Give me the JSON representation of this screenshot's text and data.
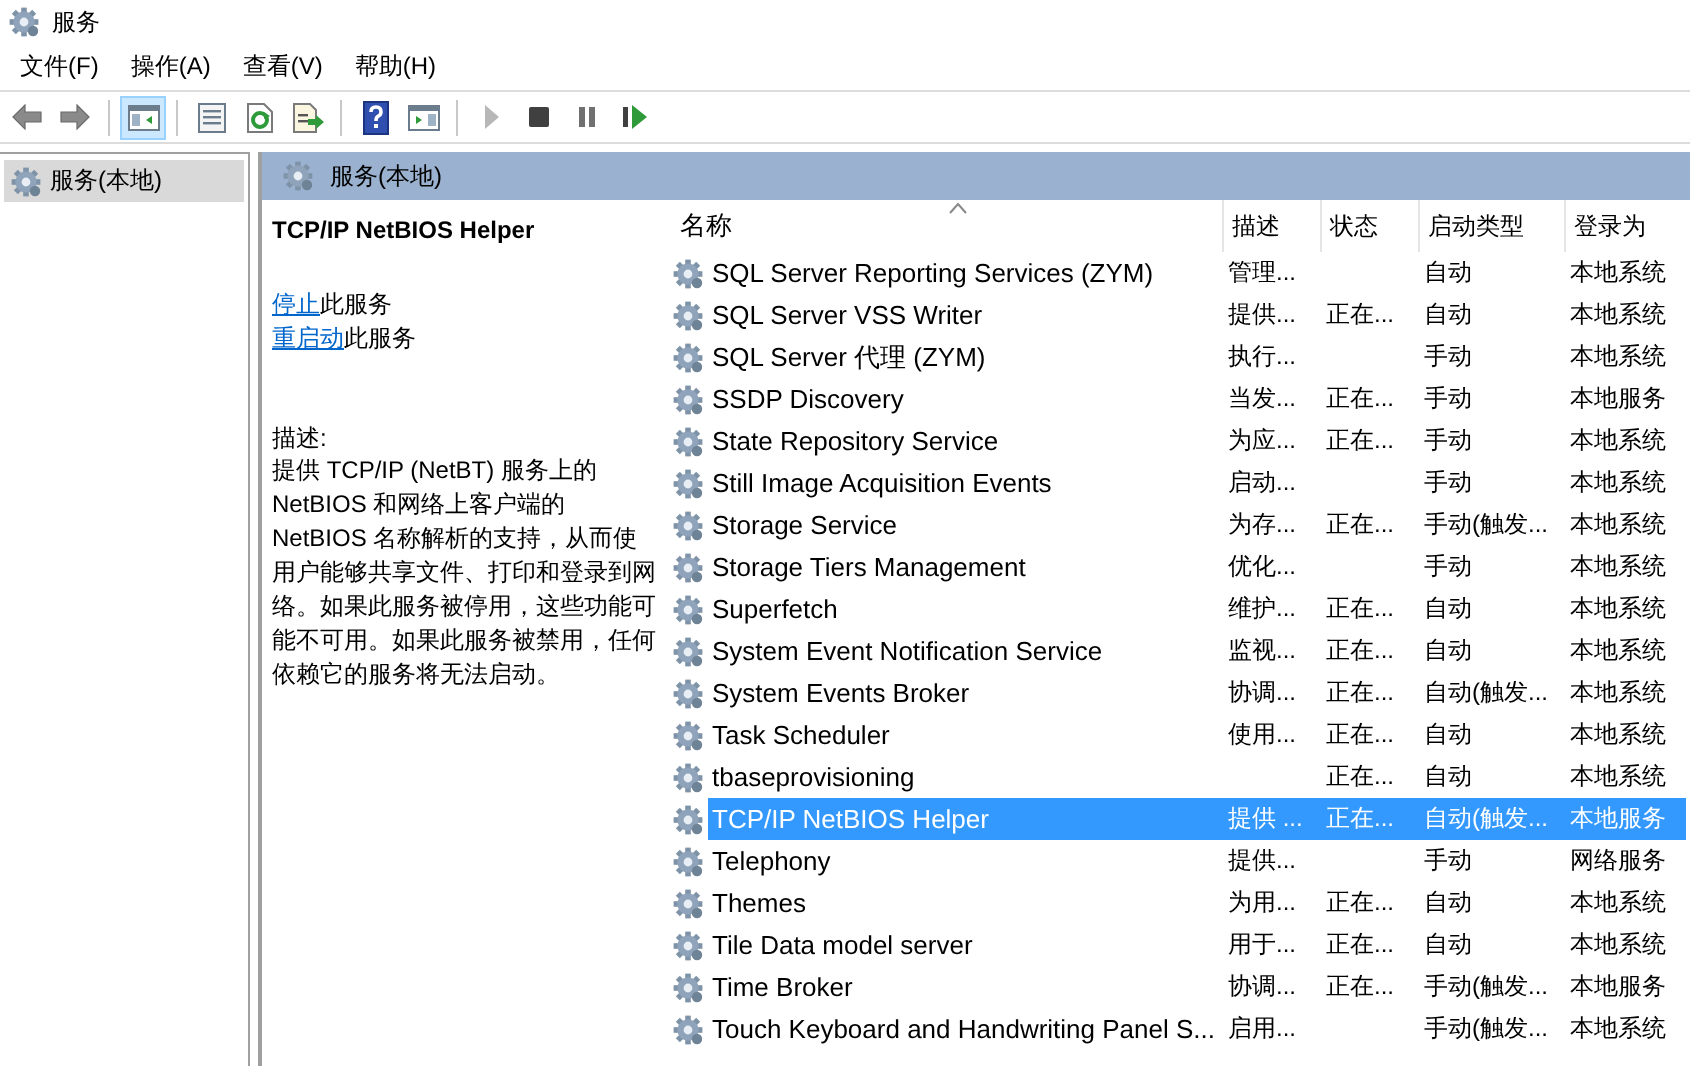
{
  "window": {
    "title": "服务"
  },
  "menu": [
    "文件(F)",
    "操作(A)",
    "查看(V)",
    "帮助(H)"
  ],
  "toolbar": [
    {
      "kind": "back",
      "selected": false,
      "disabled": false
    },
    {
      "kind": "forward",
      "selected": false,
      "disabled": false
    },
    {
      "kind": "sep"
    },
    {
      "kind": "tree",
      "selected": true,
      "disabled": false
    },
    {
      "kind": "sep"
    },
    {
      "kind": "properties",
      "selected": false,
      "disabled": false
    },
    {
      "kind": "refresh",
      "selected": false,
      "disabled": false
    },
    {
      "kind": "export",
      "selected": false,
      "disabled": false
    },
    {
      "kind": "sep"
    },
    {
      "kind": "help",
      "selected": false,
      "disabled": false
    },
    {
      "kind": "panel",
      "selected": false,
      "disabled": false
    },
    {
      "kind": "sep"
    },
    {
      "kind": "start",
      "selected": false,
      "disabled": true
    },
    {
      "kind": "stop",
      "selected": false,
      "disabled": false
    },
    {
      "kind": "pause",
      "selected": false,
      "disabled": false
    },
    {
      "kind": "resume",
      "selected": false,
      "disabled": false
    }
  ],
  "tree": [
    {
      "label": "服务(本地)",
      "selected": true
    }
  ],
  "header": {
    "title": "服务(本地)"
  },
  "details": {
    "title": "TCP/IP NetBIOS Helper",
    "actions": [
      {
        "link": "停止",
        "text": "此服务"
      },
      {
        "link": "重启动",
        "text": "此服务"
      }
    ],
    "description_label": "描述:",
    "description": "提供 TCP/IP (NetBT) 服务上的 NetBIOS 和网络上客户端的 NetBIOS 名称解析的支持，从而使用户能够共享文件、打印和登录到网络。如果此服务被停用，这些功能可能不可用。如果此服务被禁用，任何依赖它的服务将无法启动。"
  },
  "table": {
    "columns": [
      {
        "label": "名称",
        "sorted": true
      },
      {
        "label": "描述",
        "sorted": false
      },
      {
        "label": "状态",
        "sorted": false
      },
      {
        "label": "启动类型",
        "sorted": false
      },
      {
        "label": "登录为",
        "sorted": false
      }
    ],
    "rows": [
      {
        "cells": [
          "SQL Server Reporting Services (ZYM)",
          "管理...",
          "",
          "自动",
          "本地系统"
        ],
        "selected": false
      },
      {
        "cells": [
          "SQL Server VSS Writer",
          "提供...",
          "正在...",
          "自动",
          "本地系统"
        ],
        "selected": false
      },
      {
        "cells": [
          "SQL Server 代理 (ZYM)",
          "执行...",
          "",
          "手动",
          "本地系统"
        ],
        "selected": false
      },
      {
        "cells": [
          "SSDP Discovery",
          "当发...",
          "正在...",
          "手动",
          "本地服务"
        ],
        "selected": false
      },
      {
        "cells": [
          "State Repository Service",
          "为应...",
          "正在...",
          "手动",
          "本地系统"
        ],
        "selected": false
      },
      {
        "cells": [
          "Still Image Acquisition Events",
          "启动...",
          "",
          "手动",
          "本地系统"
        ],
        "selected": false
      },
      {
        "cells": [
          "Storage Service",
          "为存...",
          "正在...",
          "手动(触发...",
          "本地系统"
        ],
        "selected": false
      },
      {
        "cells": [
          "Storage Tiers Management",
          "优化...",
          "",
          "手动",
          "本地系统"
        ],
        "selected": false
      },
      {
        "cells": [
          "Superfetch",
          "维护...",
          "正在...",
          "自动",
          "本地系统"
        ],
        "selected": false
      },
      {
        "cells": [
          "System Event Notification Service",
          "监视...",
          "正在...",
          "自动",
          "本地系统"
        ],
        "selected": false
      },
      {
        "cells": [
          "System Events Broker",
          "协调...",
          "正在...",
          "自动(触发...",
          "本地系统"
        ],
        "selected": false
      },
      {
        "cells": [
          "Task Scheduler",
          "使用...",
          "正在...",
          "自动",
          "本地系统"
        ],
        "selected": false
      },
      {
        "cells": [
          "tbaseprovisioning",
          "",
          "正在...",
          "自动",
          "本地系统"
        ],
        "selected": false
      },
      {
        "cells": [
          "TCP/IP NetBIOS Helper",
          "提供 ...",
          "正在...",
          "自动(触发...",
          "本地服务"
        ],
        "selected": true
      },
      {
        "cells": [
          "Telephony",
          "提供...",
          "",
          "手动",
          "网络服务"
        ],
        "selected": false
      },
      {
        "cells": [
          "Themes",
          "为用...",
          "正在...",
          "自动",
          "本地系统"
        ],
        "selected": false
      },
      {
        "cells": [
          "Tile Data model server",
          "用于...",
          "正在...",
          "自动",
          "本地系统"
        ],
        "selected": false
      },
      {
        "cells": [
          "Time Broker",
          "协调...",
          "正在...",
          "手动(触发...",
          "本地服务"
        ],
        "selected": false
      },
      {
        "cells": [
          "Touch Keyboard and Handwriting Panel S...",
          "启用...",
          "",
          "手动(触发...",
          "本地系统"
        ],
        "selected": false
      }
    ]
  }
}
